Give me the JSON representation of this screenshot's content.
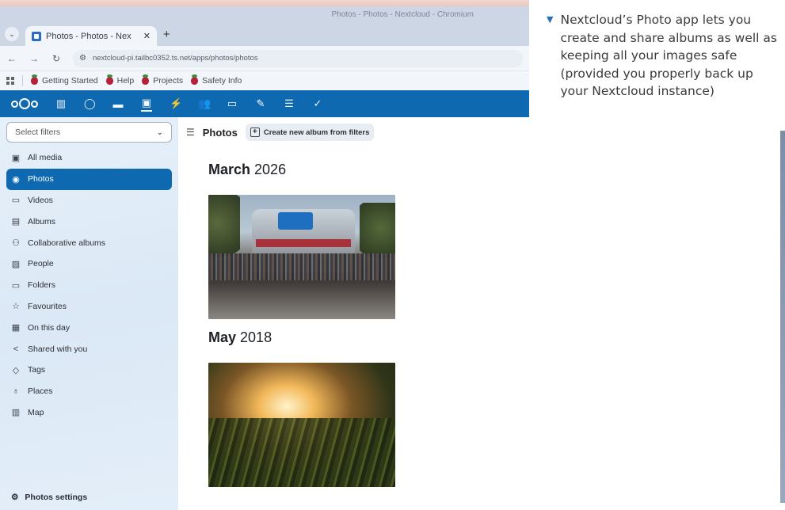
{
  "window": {
    "title": "Photos - Photos - Nextcloud - Chromium"
  },
  "tab": {
    "title": "Photos - Photos - Nex",
    "close": "✕",
    "new": "+"
  },
  "address": {
    "url": "nextcloud-pi.tailbc0352.ts.net/apps/photos/photos"
  },
  "bookmarks": [
    "Getting Started",
    "Help",
    "Projects",
    "Safety Info"
  ],
  "header": {
    "apps": [
      "dashboard-icon",
      "search-icon",
      "files-icon",
      "photos-icon",
      "activity-icon",
      "contacts-icon",
      "calendar-icon",
      "notes-icon",
      "deck-icon",
      "tasks-icon"
    ]
  },
  "sidebar": {
    "filter_placeholder": "Select filters",
    "items": [
      {
        "label": "All media",
        "icon": "all-media-icon"
      },
      {
        "label": "Photos",
        "icon": "camera-icon"
      },
      {
        "label": "Videos",
        "icon": "video-icon"
      },
      {
        "label": "Albums",
        "icon": "albums-icon"
      },
      {
        "label": "Collaborative albums",
        "icon": "group-icon"
      },
      {
        "label": "People",
        "icon": "people-icon"
      },
      {
        "label": "Folders",
        "icon": "folder-icon"
      },
      {
        "label": "Favourites",
        "icon": "star-icon"
      },
      {
        "label": "On this day",
        "icon": "calendar-icon"
      },
      {
        "label": "Shared with you",
        "icon": "share-icon"
      },
      {
        "label": "Tags",
        "icon": "tag-icon"
      },
      {
        "label": "Places",
        "icon": "pin-icon"
      },
      {
        "label": "Map",
        "icon": "map-icon"
      }
    ],
    "settings_label": "Photos settings"
  },
  "main": {
    "title": "Photos",
    "create_album_label": "Create new album from filters",
    "sections": [
      {
        "month": "March",
        "year": "2026"
      },
      {
        "month": "May",
        "year": "2018"
      }
    ]
  },
  "caption": {
    "text": "Nextcloud’s Photo app lets you create and share albums as well as keeping all your images safe (provided you properly back up your Nextcloud instance)"
  },
  "colors": {
    "nextcloud_blue": "#0f69b1",
    "caption_arrow": "#2a6fae"
  }
}
